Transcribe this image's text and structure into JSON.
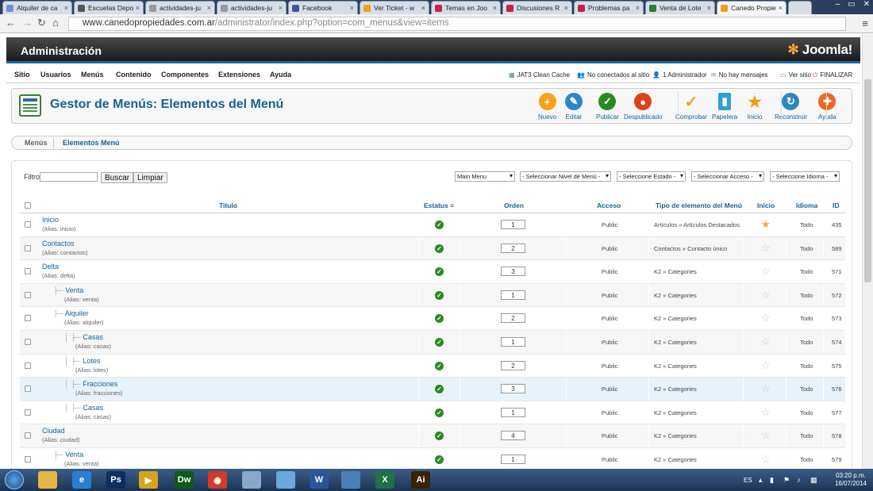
{
  "browser": {
    "tabs": [
      {
        "label": "Alquiler de ca",
        "color": "#6b8fd6"
      },
      {
        "label": "Escuelas Depo",
        "color": "#555"
      },
      {
        "label": "actividades-ju",
        "color": "#999"
      },
      {
        "label": "actividades-ju",
        "color": "#999"
      },
      {
        "label": "Facebook",
        "color": "#3b5998"
      },
      {
        "label": "Ver Ticket - w",
        "color": "#e8a317"
      },
      {
        "label": "Temas en Joo",
        "color": "#c4224a"
      },
      {
        "label": "Discusiones R",
        "color": "#c4224a"
      },
      {
        "label": "Problemas pa",
        "color": "#c4224a"
      },
      {
        "label": "Venta de Lote",
        "color": "#2e7d32"
      },
      {
        "label": "Canedo Propie",
        "color": "#f39c12"
      }
    ],
    "url_host": "www.canedopropiedades.com.ar",
    "url_path": "/administrator/index.php?option=com_menus&view=items"
  },
  "header": {
    "title": "Administración",
    "logo": "Joomla!"
  },
  "topmenu": [
    "Sitio",
    "Usuarios",
    "Menús",
    "Contenido",
    "Componentes",
    "Extensiones",
    "Ayuda"
  ],
  "status": {
    "cache": "JAT3 Clean Cache",
    "visitors": "No conectados al sitio",
    "admins": "1 Administrador",
    "messages": "No hay mensajes",
    "view_site": "Ver sitio",
    "logout": "FINALIZAR"
  },
  "page_title": "Gestor de Menús: Elementos del Menú",
  "toolbar": [
    {
      "label": "Nuevo",
      "icon": "plus-icon",
      "color": "#f7a21b"
    },
    {
      "label": "Editar",
      "icon": "pencil-icon",
      "color": "#2e86c1"
    },
    {
      "label": "Publicar",
      "icon": "check-icon",
      "color": "#2a8a22"
    },
    {
      "label": "Despublicado",
      "icon": "no-icon",
      "color": "#e2401c"
    },
    {
      "label": "Comprobar",
      "icon": "checkmark-icon",
      "color": "#f7a21b"
    },
    {
      "label": "Papelera",
      "icon": "trash-icon",
      "color": "#2aa0d8"
    },
    {
      "label": "Inicio",
      "icon": "star-icon",
      "color": "#f39c12"
    },
    {
      "label": "Reconstruir",
      "icon": "refresh-icon",
      "color": "#2e86c1"
    },
    {
      "label": "Ayuda",
      "icon": "lifebuoy-icon",
      "color": "#f26522"
    }
  ],
  "submenu": [
    "Menús",
    "Elementos Menú"
  ],
  "filter": {
    "label": "Filtro:",
    "search_button": "Buscar",
    "clear_button": "Limpiar",
    "selects": [
      "Main Menu",
      "- Seleccionar Nivel de Menú -",
      "- Seleccione Estado -",
      "- Seleccionar Acceso -",
      "- Seleccione Idioma -"
    ]
  },
  "table": {
    "headers": {
      "titulo": "Titulo",
      "estatus": "Estatus",
      "orden": "Orden",
      "acceso": "Acceso",
      "tipo": "Tipo de elemento del Menú",
      "inicio": "Inicio",
      "idioma": "Idioma",
      "id": "ID"
    },
    "rows": [
      {
        "title": "Inicio",
        "alias": "(Alias: inicio)",
        "level": 0,
        "order": "1",
        "access": "Public",
        "type": "Artículos » Artículos Destacados",
        "home": true,
        "lang": "Todo",
        "id": "435"
      },
      {
        "title": "Contactos",
        "alias": "(Alias: contactos)",
        "level": 0,
        "order": "2",
        "access": "Public",
        "type": "Contactos » Contacto único",
        "home": false,
        "lang": "Todo",
        "id": "589"
      },
      {
        "title": "Delta",
        "alias": "(Alias: delta)",
        "level": 0,
        "order": "3",
        "access": "Public",
        "type": "K2 » Categories",
        "home": false,
        "lang": "Todo",
        "id": "571"
      },
      {
        "title": "Venta",
        "alias": "(Alias: venta)",
        "level": 1,
        "order": "1",
        "access": "Public",
        "type": "K2 » Categories",
        "home": false,
        "lang": "Todo",
        "id": "572"
      },
      {
        "title": "Alquiler",
        "alias": "(Alias: alquiler)",
        "level": 1,
        "order": "2",
        "access": "Public",
        "type": "K2 » Categories",
        "home": false,
        "lang": "Todo",
        "id": "573"
      },
      {
        "title": "Casas",
        "alias": "(Alias: casas)",
        "level": 2,
        "order": "1",
        "access": "Public",
        "type": "K2 » Categories",
        "home": false,
        "lang": "Todo",
        "id": "574"
      },
      {
        "title": "Lotes",
        "alias": "(Alias: lotes)",
        "level": 2,
        "order": "2",
        "access": "Public",
        "type": "K2 » Categories",
        "home": false,
        "lang": "Todo",
        "id": "575"
      },
      {
        "title": "Fracciones",
        "alias": "(Alias: fracciones)",
        "level": 2,
        "order": "3",
        "access": "Public",
        "type": "K2 » Categories",
        "home": false,
        "lang": "Todo",
        "id": "576"
      },
      {
        "title": "Casas",
        "alias": "(Alias: casas)",
        "level": 2,
        "order": "1",
        "access": "Public",
        "type": "K2 » Categories",
        "home": false,
        "lang": "Todo",
        "id": "577"
      },
      {
        "title": "Ciudad",
        "alias": "(Alias: ciudad)",
        "level": 0,
        "order": "4",
        "access": "Public",
        "type": "K2 » Categories",
        "home": false,
        "lang": "Todo",
        "id": "578"
      },
      {
        "title": "Venta",
        "alias": "(Alias: venta)",
        "level": 1,
        "order": "1",
        "access": "Public",
        "type": "K2 » Categories",
        "home": false,
        "lang": "Todo",
        "id": "579"
      }
    ]
  },
  "taskbar": {
    "lang": "ES",
    "time": "03:20 p.m.",
    "date": "16/07/2014",
    "apps": [
      {
        "icon": "explorer-icon",
        "color": "#e6b646",
        "label": ""
      },
      {
        "icon": "ie-icon",
        "color": "#2a7fd4",
        "label": "e"
      },
      {
        "icon": "photoshop-icon",
        "color": "#0b2f5f",
        "label": "Ps"
      },
      {
        "icon": "media-icon",
        "color": "#d7a321",
        "label": "▶"
      },
      {
        "icon": "dreamweaver-icon",
        "color": "#0f5a1a",
        "label": "Dw"
      },
      {
        "icon": "chrome-icon",
        "color": "#d23b2a",
        "label": "◉"
      },
      {
        "icon": "folder-icon",
        "color": "#8aa9c9",
        "label": ""
      },
      {
        "icon": "pen-icon",
        "color": "#6aa9d9",
        "label": ""
      },
      {
        "icon": "word-icon",
        "color": "#2b579a",
        "label": "W"
      },
      {
        "icon": "window-icon",
        "color": "#4a7fb5",
        "label": ""
      },
      {
        "icon": "excel-icon",
        "color": "#1e7145",
        "label": "X"
      },
      {
        "icon": "illustrator-icon",
        "color": "#3a2205",
        "label": "Ai"
      }
    ]
  }
}
